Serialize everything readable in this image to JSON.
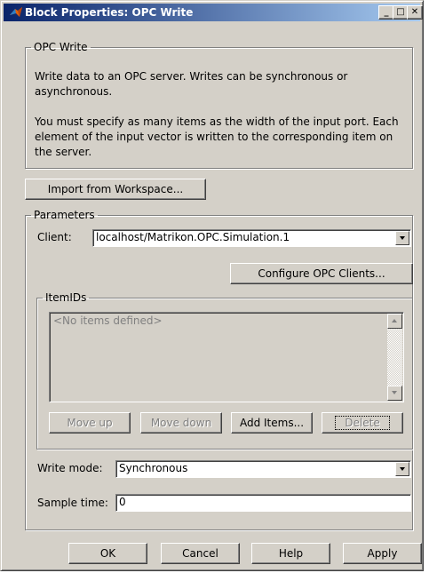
{
  "window": {
    "title": "Block Properties: OPC Write",
    "controls": [
      "minimize-icon",
      "maximize-icon",
      "close-icon"
    ]
  },
  "description_group": {
    "legend": "OPC Write",
    "paragraph1": "Write data to an OPC server. Writes can be synchronous or asynchronous.",
    "paragraph2": "You must specify as many items as the width of the input port. Each element of the input vector is written to the corresponding item on the server."
  },
  "import_button": "Import from Workspace...",
  "parameters": {
    "legend": "Parameters",
    "client_label": "Client:",
    "client_value": "localhost/Matrikon.OPC.Simulation.1",
    "configure_button": "Configure OPC Clients...",
    "itemids": {
      "legend": "ItemIDs",
      "placeholder": "<No items defined>",
      "move_up": "Move up",
      "move_down": "Move down",
      "add_items": "Add Items...",
      "delete": "Delete"
    },
    "write_mode_label": "Write mode:",
    "write_mode_value": "Synchronous",
    "sample_time_label": "Sample time:",
    "sample_time_value": "0"
  },
  "buttons": {
    "ok": "OK",
    "cancel": "Cancel",
    "help": "Help",
    "apply": "Apply"
  },
  "colors": {
    "dialog_bg": "#d4d0c8",
    "title_gradient_start": "#0a246a",
    "title_gradient_end": "#a6caf0",
    "disabled_text": "#808080"
  }
}
